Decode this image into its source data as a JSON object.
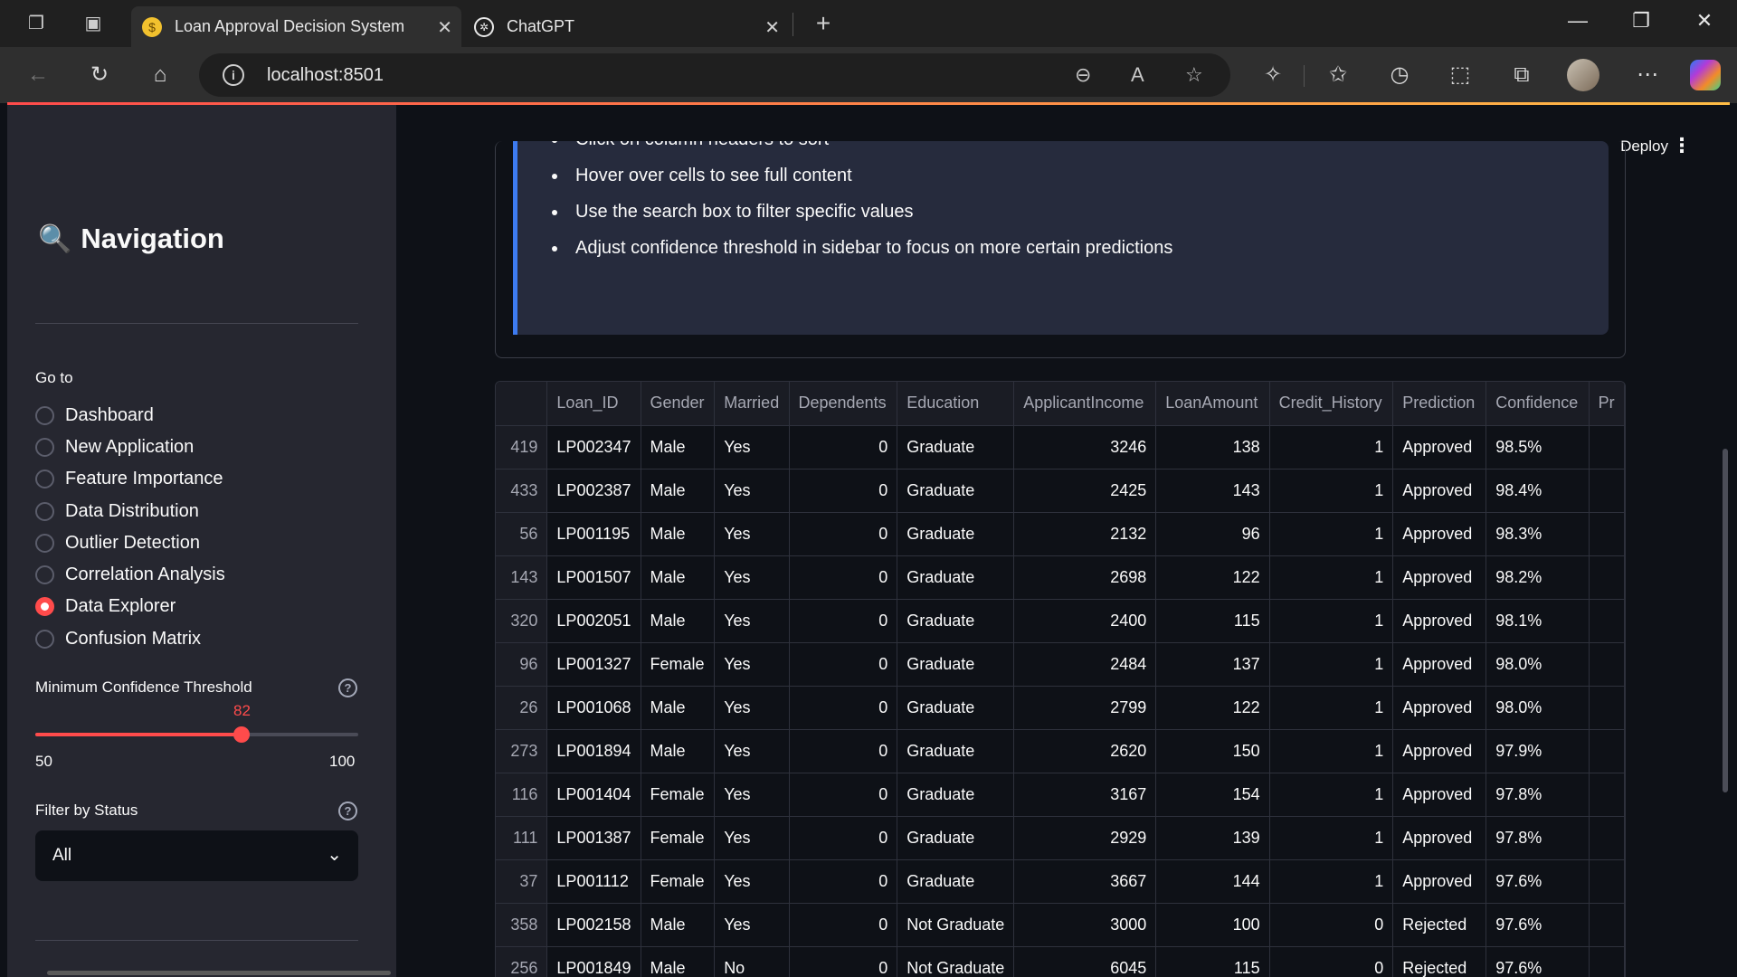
{
  "browser": {
    "tabs": [
      {
        "title": "Loan Approval Decision System",
        "active": true,
        "icon": "money-bag-icon"
      },
      {
        "title": "ChatGPT",
        "active": false,
        "icon": "openai-icon"
      }
    ],
    "url": "localhost:8501"
  },
  "sidebar": {
    "title": "Navigation",
    "goto_label": "Go to",
    "nav_items": [
      {
        "label": "Dashboard",
        "selected": false
      },
      {
        "label": "New Application",
        "selected": false
      },
      {
        "label": "Feature Importance",
        "selected": false
      },
      {
        "label": "Data Distribution",
        "selected": false
      },
      {
        "label": "Outlier Detection",
        "selected": false
      },
      {
        "label": "Correlation Analysis",
        "selected": false
      },
      {
        "label": "Data Explorer",
        "selected": true
      },
      {
        "label": "Confusion Matrix",
        "selected": false
      }
    ],
    "slider": {
      "label": "Minimum Confidence Threshold",
      "value": "82",
      "min": "50",
      "max": "100"
    },
    "filter": {
      "label": "Filter by Status",
      "value": "All"
    }
  },
  "header": {
    "deploy_label": "Deploy"
  },
  "tips": [
    "Click on column headers to sort",
    "Hover over cells to see full content",
    "Use the search box to filter specific values",
    "Adjust confidence threshold in sidebar to focus on more certain predictions"
  ],
  "table": {
    "columns": [
      "",
      "Loan_ID",
      "Gender",
      "Married",
      "Dependents",
      "Education",
      "ApplicantIncome",
      "LoanAmount",
      "Credit_History",
      "Prediction",
      "Confidence",
      "Pr"
    ],
    "rows": [
      [
        "419",
        "LP002347",
        "Male",
        "Yes",
        "0",
        "Graduate",
        "3246",
        "138",
        "1",
        "Approved",
        "98.5%",
        ""
      ],
      [
        "433",
        "LP002387",
        "Male",
        "Yes",
        "0",
        "Graduate",
        "2425",
        "143",
        "1",
        "Approved",
        "98.4%",
        ""
      ],
      [
        "56",
        "LP001195",
        "Male",
        "Yes",
        "0",
        "Graduate",
        "2132",
        "96",
        "1",
        "Approved",
        "98.3%",
        ""
      ],
      [
        "143",
        "LP001507",
        "Male",
        "Yes",
        "0",
        "Graduate",
        "2698",
        "122",
        "1",
        "Approved",
        "98.2%",
        ""
      ],
      [
        "320",
        "LP002051",
        "Male",
        "Yes",
        "0",
        "Graduate",
        "2400",
        "115",
        "1",
        "Approved",
        "98.1%",
        ""
      ],
      [
        "96",
        "LP001327",
        "Female",
        "Yes",
        "0",
        "Graduate",
        "2484",
        "137",
        "1",
        "Approved",
        "98.0%",
        ""
      ],
      [
        "26",
        "LP001068",
        "Male",
        "Yes",
        "0",
        "Graduate",
        "2799",
        "122",
        "1",
        "Approved",
        "98.0%",
        ""
      ],
      [
        "273",
        "LP001894",
        "Male",
        "Yes",
        "0",
        "Graduate",
        "2620",
        "150",
        "1",
        "Approved",
        "97.9%",
        ""
      ],
      [
        "116",
        "LP001404",
        "Female",
        "Yes",
        "0",
        "Graduate",
        "3167",
        "154",
        "1",
        "Approved",
        "97.8%",
        ""
      ],
      [
        "111",
        "LP001387",
        "Female",
        "Yes",
        "0",
        "Graduate",
        "2929",
        "139",
        "1",
        "Approved",
        "97.8%",
        ""
      ],
      [
        "37",
        "LP001112",
        "Female",
        "Yes",
        "0",
        "Graduate",
        "3667",
        "144",
        "1",
        "Approved",
        "97.6%",
        ""
      ],
      [
        "358",
        "LP002158",
        "Male",
        "Yes",
        "0",
        "Not Graduate",
        "3000",
        "100",
        "0",
        "Rejected",
        "97.6%",
        ""
      ],
      [
        "256",
        "LP001849",
        "Male",
        "No",
        "0",
        "Not Graduate",
        "6045",
        "115",
        "0",
        "Rejected",
        "97.6%",
        ""
      ]
    ]
  },
  "colors": {
    "accent": "#ff4b4b",
    "sidebar_bg": "#262730",
    "app_bg": "#0e1117",
    "info_bg": "#262b3d",
    "info_border": "#3d7bf0"
  }
}
